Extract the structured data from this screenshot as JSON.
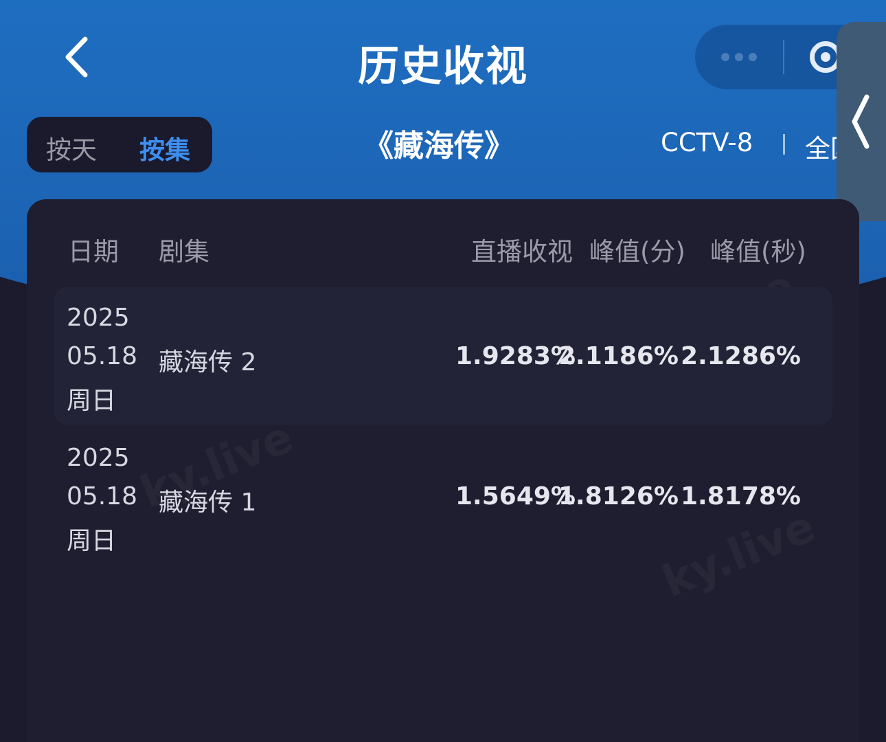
{
  "header": {
    "back_icon": "chevron-left-icon",
    "title": "历史收视",
    "capsule": {
      "more_icon": "more-dots-icon",
      "close_icon": "target-close-icon"
    },
    "side_handle_icon": "chevron-left-icon"
  },
  "filters": {
    "tabs": [
      {
        "label": "按天",
        "active": false
      },
      {
        "label": "按集",
        "active": true
      }
    ],
    "show_title": "《藏海传》",
    "channel": "CCTV-8",
    "region": "全国"
  },
  "table": {
    "columns": [
      "日期",
      "剧集",
      "直播收视",
      "峰值(分)",
      "峰值(秒)"
    ],
    "rows": [
      {
        "year": "2025",
        "month_day": "05.18",
        "weekday": "周日",
        "episode": "藏海传 2",
        "live": "1.9283%",
        "peak_min": "2.1186%",
        "peak_sec": "2.1286%"
      },
      {
        "year": "2025",
        "month_day": "05.18",
        "weekday": "周日",
        "episode": "藏海传 1",
        "live": "1.5649%",
        "peak_min": "1.8126%",
        "peak_sec": "1.8178%"
      }
    ]
  },
  "watermark": "ky.live",
  "colors": {
    "header_blue": "#1a73c9",
    "active_tab": "#3d8ef0",
    "background": "#1b1b2d",
    "card": "#1e1e30"
  }
}
